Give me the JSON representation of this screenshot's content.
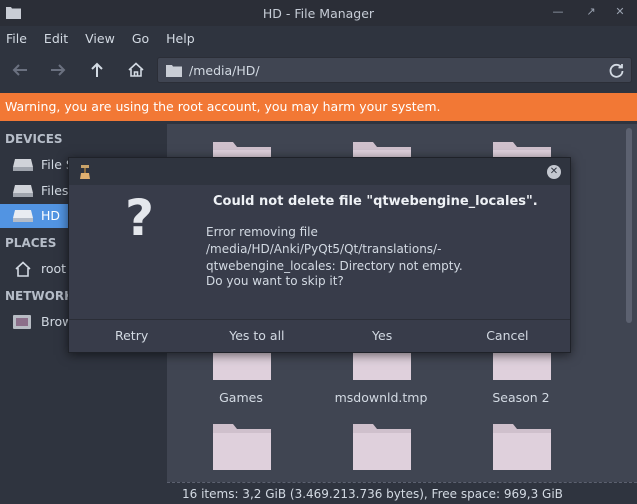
{
  "window": {
    "title": "HD - File Manager"
  },
  "menu": {
    "items": [
      "File",
      "Edit",
      "View",
      "Go",
      "Help"
    ]
  },
  "address": {
    "path": "/media/HD/"
  },
  "warning": {
    "text": "Warning, you are using the root account, you may harm your system."
  },
  "sidebar": {
    "devices_header": "DEVICES",
    "devices": [
      "File S",
      "Filesy",
      "HD"
    ],
    "places_header": "PLACES",
    "places": [
      "root"
    ],
    "network_header": "NETWORK",
    "network": [
      "Brow"
    ]
  },
  "folders": {
    "row2": [
      "Games",
      "msdownld.tmp",
      "Season 2"
    ]
  },
  "status": {
    "text": "16 items: 3,2 GiB (3.469.213.736 bytes), Free space: 969,3 GiB"
  },
  "dialog": {
    "heading": "Could not delete file \"qtwebengine_locales\".",
    "message": "Error removing file /media/HD/Anki/PyQt5/Qt/translations/-qtwebengine_locales: Directory not empty.",
    "question": "Do you want to skip it?",
    "buttons": [
      "Retry",
      "Yes to all",
      "Yes",
      "Cancel"
    ]
  },
  "colors": {
    "accent": "#5294e2",
    "warning": "#f27835",
    "folder": "#dfd0dc"
  }
}
